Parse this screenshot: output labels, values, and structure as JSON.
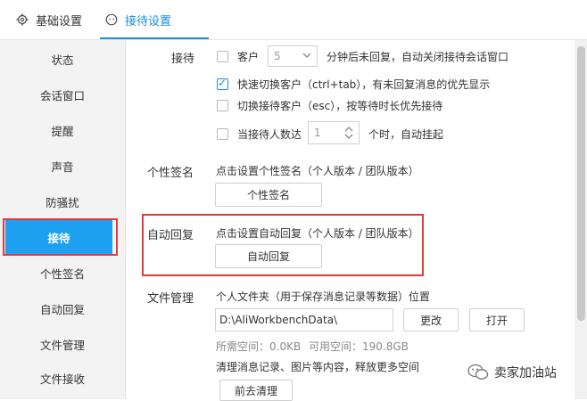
{
  "tabs": [
    {
      "label": "基础设置",
      "icon": "gear-icon"
    },
    {
      "label": "接待设置",
      "icon": "chat-bubble-icon",
      "active": true
    }
  ],
  "sidebar": {
    "items": [
      {
        "label": "状态"
      },
      {
        "label": "会话窗口"
      },
      {
        "label": "提醒"
      },
      {
        "label": "声音"
      },
      {
        "label": "防骚扰"
      },
      {
        "label": "接待",
        "active": true
      },
      {
        "label": "个性签名"
      },
      {
        "label": "自动回复"
      },
      {
        "label": "文件管理"
      },
      {
        "label": "文件接收"
      }
    ]
  },
  "reception": {
    "section_label": "接待",
    "customer": {
      "checkbox_label": "客户",
      "minutes_value": "5",
      "suffix": "分钟后未回复，自动关闭接待会话窗口",
      "checked": false
    },
    "quick_switch": {
      "label": "快速切换客户（ctrl+tab），有未回复消息的优先显示",
      "checked": true
    },
    "switch_customer": {
      "label": "切换接待客户（esc），按等待时长优先接待",
      "checked": false
    },
    "auto_hangup": {
      "label": "当接待人数达",
      "value": "1",
      "suffix": "个时，自动挂起",
      "checked": false
    }
  },
  "signature": {
    "section_label": "个性签名",
    "description": "点击设置个性签名（个人版本 / 团队版本）",
    "button_label": "个性签名"
  },
  "auto_reply": {
    "section_label": "自动回复",
    "description": "点击设置自动回复（个人版本 / 团队版本）",
    "button_label": "自动回复"
  },
  "file_management": {
    "section_label": "文件管理",
    "description": "个人文件夹（用于保存消息记录等数据）位置",
    "path_value": "D:\\AliWorkbenchData\\",
    "change_button": "更改",
    "open_button": "打开",
    "used_space": "所需空间：0.0KB",
    "free_space": "可用空间：190.8GB",
    "clean_description": "清理消息记录、图片等内容，释放更多空间",
    "clean_button": "前去清理"
  },
  "watermark": {
    "text": "卖家加油站",
    "icon": "wechat-icon"
  },
  "colors": {
    "accent": "#1a8ee0",
    "active_nav": "#1ea0f0",
    "highlight": "#e23b3b"
  }
}
